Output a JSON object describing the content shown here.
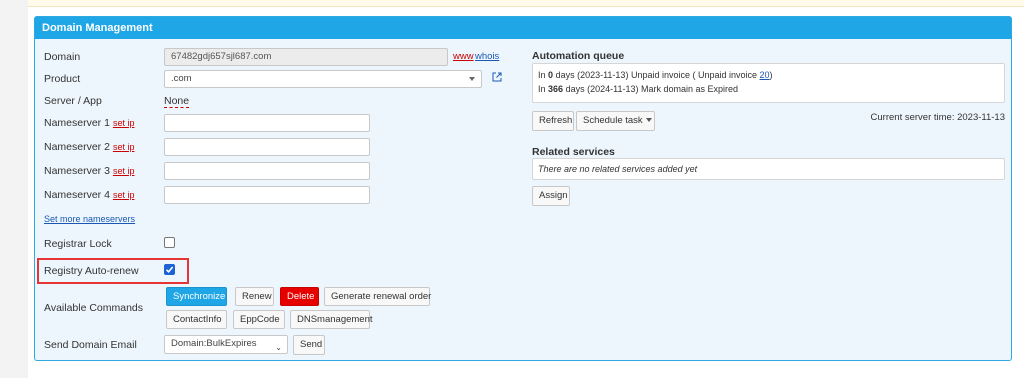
{
  "panel": {
    "title": "Domain Management"
  },
  "form": {
    "domain_label": "Domain",
    "domain_value": "67482gdj657sjl687.com",
    "www_link": "www",
    "whois_link": "whois",
    "product_label": "Product",
    "product_value": ".com",
    "server_label": "Server / App",
    "server_value": "None",
    "ns1_label": "Nameserver 1",
    "ns2_label": "Nameserver 2",
    "ns3_label": "Nameserver 3",
    "ns4_label": "Nameserver 4",
    "set_ip": "set ip",
    "more_ns": "Set more nameservers",
    "registrar_lock_label": "Registrar Lock",
    "registrar_lock_checked": false,
    "auto_renew_label": "Registry Auto-renew",
    "auto_renew_checked": true,
    "commands_label": "Available Commands",
    "send_email_label": "Send Domain Email",
    "email_template": "Domain:BulkExpires",
    "send_btn": "Send"
  },
  "commands": {
    "synchronize": "Synchronize",
    "renew": "Renew",
    "delete": "Delete",
    "generate": "Generate renewal order",
    "contactinfo": "ContactInfo",
    "eppcode": "EppCode",
    "dnsmanagement": "DNSmanagement"
  },
  "automation": {
    "title": "Automation queue",
    "row1_prefix": "In",
    "row1_days": "0",
    "row1_text": "days (2023-11-13) Unpaid invoice ( Unpaid invoice",
    "row1_link": "20",
    "row1_suffix": ")",
    "row2_prefix": "In",
    "row2_days": "366",
    "row2_text": "days (2024-11-13) Mark domain as Expired",
    "refresh_btn": "Refresh",
    "schedule_btn": "Schedule task",
    "server_time": "Current server time: 2023-11-13"
  },
  "related": {
    "title": "Related services",
    "empty_text": "There are no related services added yet",
    "assign_btn": "Assign"
  },
  "colors": {
    "header_blue": "#1fa6e6",
    "delete_red": "#e60000",
    "highlight_red": "#e53535"
  }
}
